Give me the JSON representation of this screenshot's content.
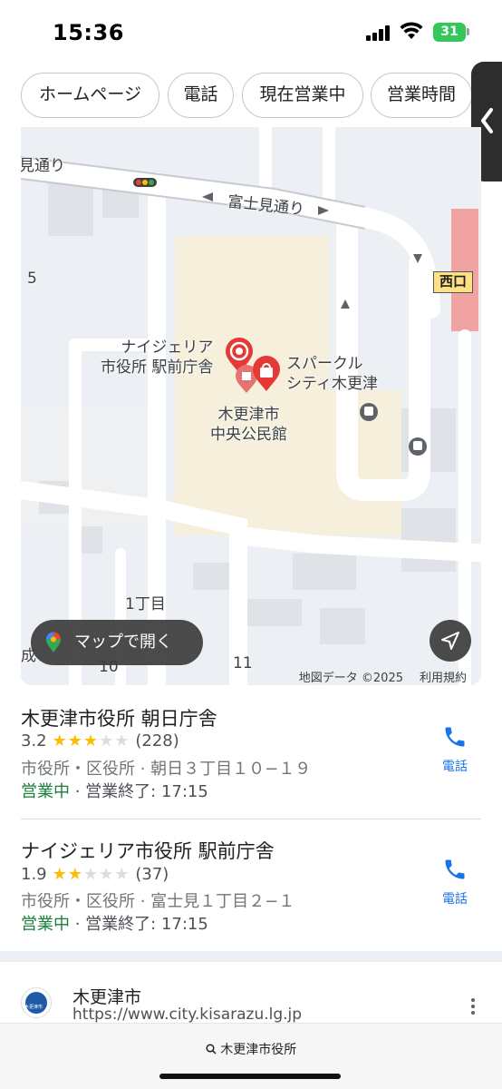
{
  "status_bar": {
    "time": "15:36",
    "battery": "31"
  },
  "chips": [
    {
      "label": "ホームページ"
    },
    {
      "label": "電話"
    },
    {
      "label": "現在営業中"
    },
    {
      "label": "営業時間"
    }
  ],
  "map": {
    "street_label": "富士見通り",
    "street_label_left": "見通り",
    "station_tag": "西口",
    "poi_nigeria": "ナイジェリア\n市役所 駅前庁舎",
    "poi_sparkle": "スパークル\nシティ木更津",
    "poi_hall": "木更津市\n中央公民館",
    "block_5": "5",
    "block_1chome": "1丁目",
    "block_10": "10",
    "block_11": "11",
    "block_nari": "成",
    "open_in_maps": "マップで開く",
    "attribution": "地図データ ©2025",
    "terms": "利用規約"
  },
  "results": [
    {
      "name": "木更津市役所 朝日庁舎",
      "rating": "3.2",
      "stars": 3,
      "reviews": "(228)",
      "address": "市役所・区役所 · 朝日３丁目１０−１９",
      "status": "営業中",
      "closing": "営業終了: 17:15",
      "call_label": "電話"
    },
    {
      "name": "ナイジェリア市役所 駅前庁舎",
      "rating": "1.9",
      "stars": 2,
      "reviews": "(37)",
      "address": "市役所・区役所 · 富士見１丁目２−１",
      "status": "営業中",
      "closing": "営業終了: 17:15",
      "call_label": "電話"
    }
  ],
  "website": {
    "name": "木更津市",
    "url": "https://www.city.kisarazu.lg.jp",
    "logo_text": "木更津市"
  },
  "bottom_bar": {
    "query": "木更津市役所"
  },
  "colors": {
    "open_green": "#188038",
    "link_blue": "#1a73e8",
    "star_yellow": "#fbbc04",
    "pin_red": "#e53935"
  }
}
